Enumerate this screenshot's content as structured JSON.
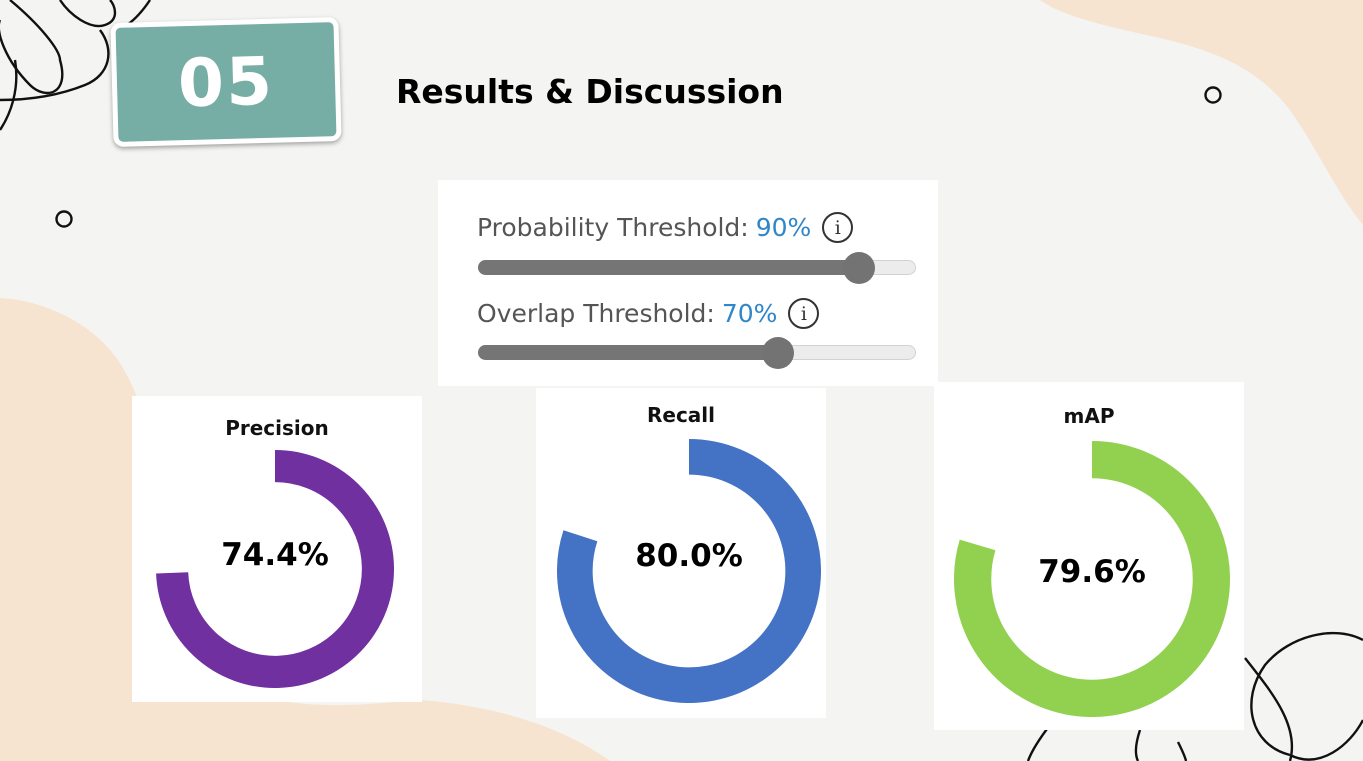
{
  "slide": {
    "number": "05",
    "title": "Results & Discussion"
  },
  "thresholds": {
    "probability": {
      "label": "Probability Threshold:",
      "value_text": "90%",
      "value": 0.9,
      "info_icon": "info-icon"
    },
    "overlap": {
      "label": "Overlap Threshold:",
      "value_text": "70%",
      "value": 0.7,
      "info_icon": "info-icon"
    }
  },
  "metrics": [
    {
      "title": "Precision",
      "value_text": "74.4%",
      "value": 0.744,
      "color": "#7030a0"
    },
    {
      "title": "Recall",
      "value_text": "80.0%",
      "value": 0.8,
      "color": "#4472c4"
    },
    {
      "title": "mAP",
      "value_text": "79.6%",
      "value": 0.796,
      "color": "#92d050"
    }
  ],
  "colors": {
    "background": "#f4f4f3",
    "blob": "#f6e4d1",
    "badge": "#76ada4",
    "accent_value": "#2f86c8",
    "slider": "#757575"
  }
}
